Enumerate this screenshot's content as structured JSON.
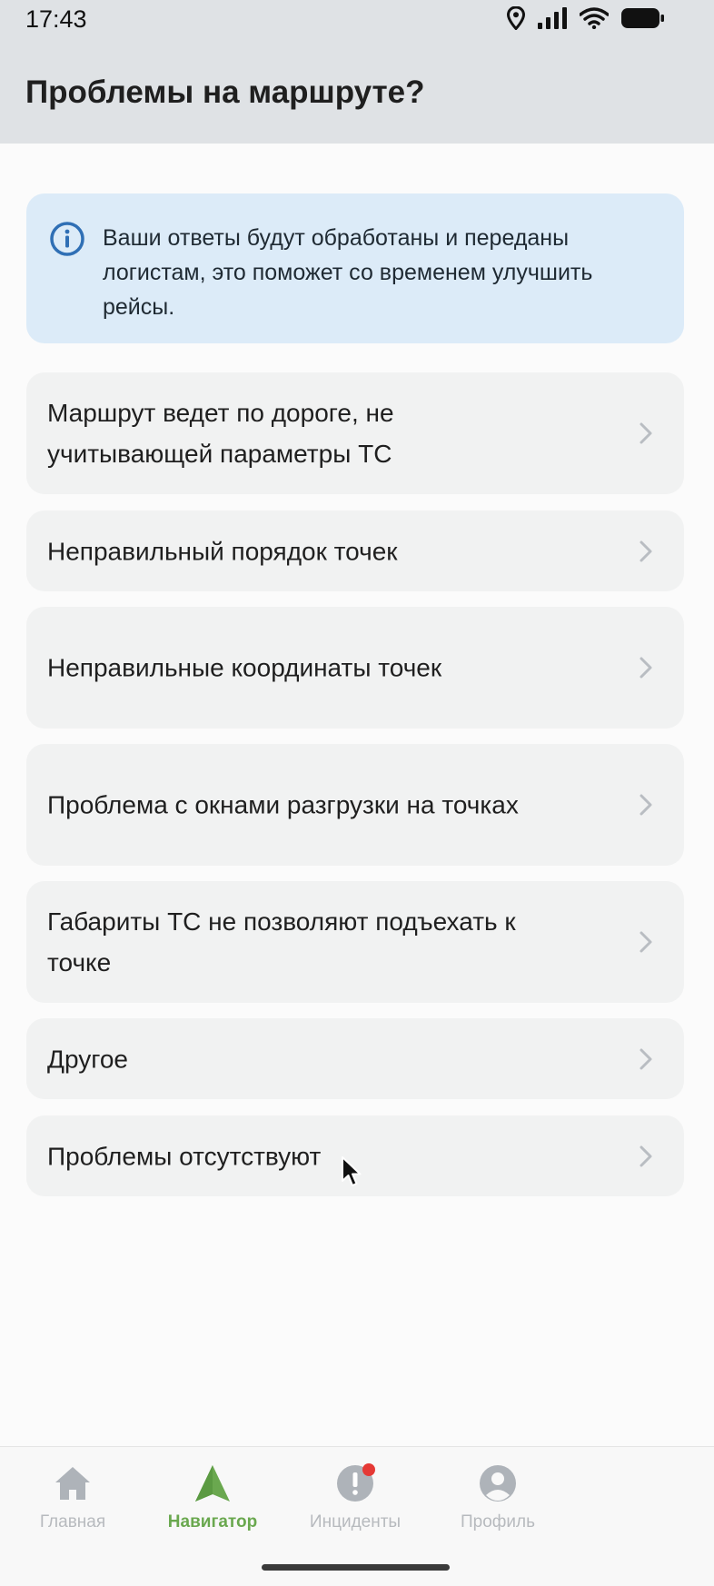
{
  "status_bar": {
    "time": "17:43"
  },
  "header": {
    "title": "Проблемы на маршруте?"
  },
  "info_banner": {
    "text": "Ваши ответы будут обработаны и переданы логистам, это поможет со временем улучшить рейсы."
  },
  "options": [
    {
      "label": "Маршрут ведет по дороге, не учитывающей параметры ТС"
    },
    {
      "label": "Неправильный порядок точек"
    },
    {
      "label": "Неправильные координаты точек"
    },
    {
      "label": "Проблема с окнами разгрузки на точках"
    },
    {
      "label": "Габариты ТС не позволяют подъехать к точке"
    },
    {
      "label": "Другое"
    },
    {
      "label": "Проблемы отсутствуют"
    }
  ],
  "bottom_nav": {
    "items": [
      {
        "label": "Главная",
        "icon": "home-icon"
      },
      {
        "label": "Навигатор",
        "icon": "navigator-arrow-icon",
        "active": true
      },
      {
        "label": "Инциденты",
        "icon": "alert-icon",
        "has_badge": true
      },
      {
        "label": "Профиль",
        "icon": "profile-icon"
      }
    ]
  },
  "colors": {
    "accent": "#6aa84f",
    "info_bg": "#dcebf8",
    "header_bg": "#dfe2e5",
    "badge": "#e53935"
  }
}
